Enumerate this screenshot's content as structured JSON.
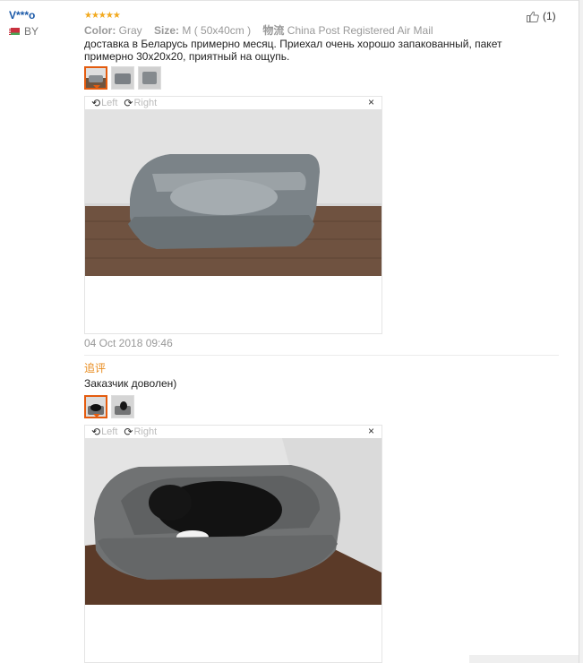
{
  "review": {
    "user": {
      "name": "V***o",
      "country": "BY"
    },
    "rating_stars": 5,
    "stars_glyphs": "★★★★★",
    "color_label": "Color:",
    "color_value": "Gray",
    "size_label": "Size:",
    "size_value": "M ( 50x40cm )",
    "shipping_label": "物流",
    "shipping_value": "China Post Registered Air Mail",
    "helpful_count": "(1)",
    "text_line1": "доставка в Беларусь примерно месяц. Приехал очень хорошо запакованный, пакет",
    "text_line2": "примерно 30x20x20, приятный на ощупь.",
    "viewer1": {
      "left_label": "Left",
      "right_label": "Right",
      "close": "×"
    },
    "date": "04 Oct 2018 09:46",
    "additional_label": "追评",
    "additional_text": "Заказчик доволен)",
    "viewer2": {
      "left_label": "Left",
      "right_label": "Right",
      "close": "×"
    }
  },
  "colors": {
    "accent": "#e45c0f",
    "stars": "#f2a91e",
    "username": "#1a59a8",
    "additional": "#e88b1d"
  }
}
